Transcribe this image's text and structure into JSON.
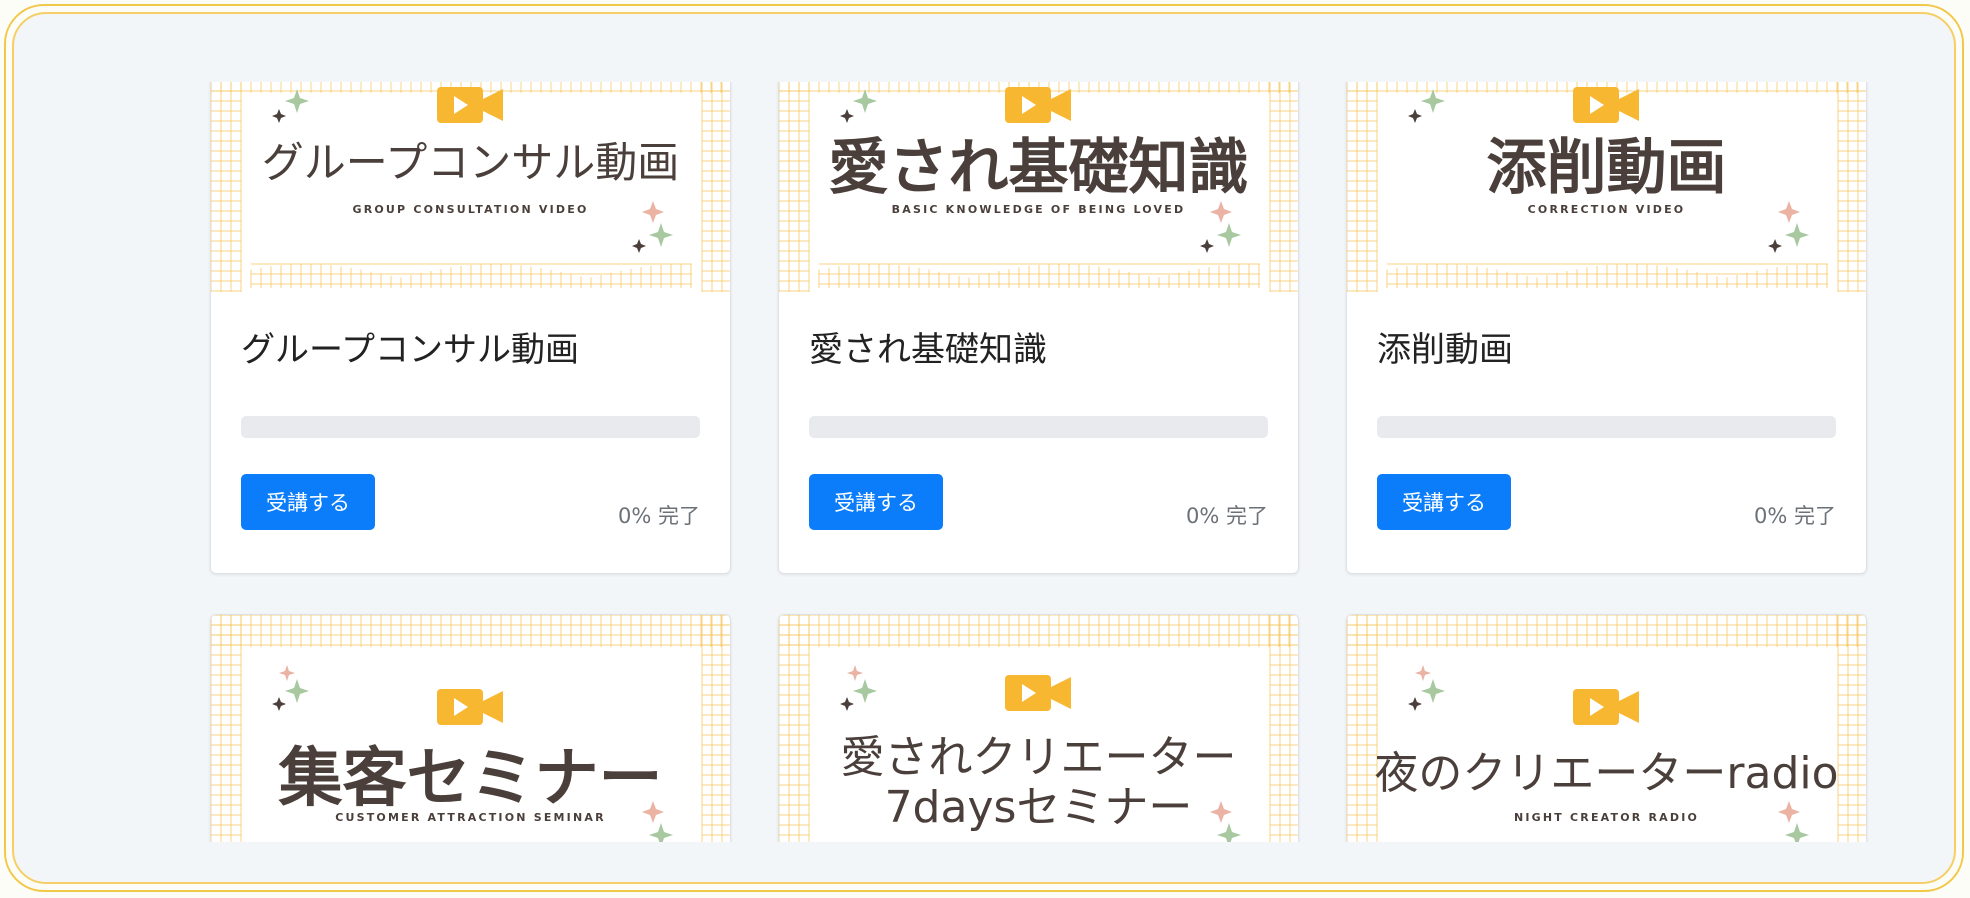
{
  "cards": [
    {
      "thumb_title": "グループコンサル動画",
      "thumb_sub": "GROUP CONSULTATION VIDEO",
      "title": "グループコンサル動画",
      "button": "受講する",
      "progress_pct": 0,
      "progress_text": "0% 完了"
    },
    {
      "thumb_title": "愛され基礎知識",
      "thumb_sub": "BASIC KNOWLEDGE OF BEING LOVED",
      "title": "愛され基礎知識",
      "button": "受講する",
      "progress_pct": 0,
      "progress_text": "0% 完了"
    },
    {
      "thumb_title": "添削動画",
      "thumb_sub": "CORRECTION VIDEO",
      "title": "添削動画",
      "button": "受講する",
      "progress_pct": 0,
      "progress_text": "0% 完了"
    },
    {
      "thumb_title": "集客セミナー",
      "thumb_sub": "CUSTOMER ATTRACTION SEMINAR"
    },
    {
      "thumb_title_line1": "愛されクリエーター",
      "thumb_title_line2": "7daysセミナー"
    },
    {
      "thumb_title": "夜のクリエーターradio",
      "thumb_sub": "NIGHT CREATOR RADIO"
    }
  ],
  "colors": {
    "accent": "#0b7dfb",
    "camera": "#f7b731",
    "grid": "#f6c55a",
    "frame": "#f2c84b"
  },
  "icons": {
    "thumb_icon": "video-camera-icon",
    "decor": "sparkle-icon"
  }
}
